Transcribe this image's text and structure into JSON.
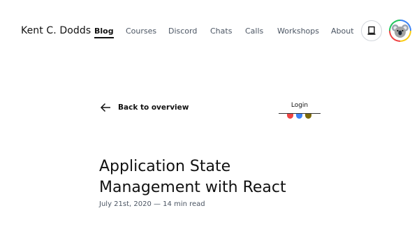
{
  "header": {
    "site_title": "Kent C. Dodds",
    "nav": [
      {
        "label": "Blog",
        "active": true
      },
      {
        "label": "Courses",
        "active": false
      },
      {
        "label": "Discord",
        "active": false
      },
      {
        "label": "Chats",
        "active": false
      },
      {
        "label": "Calls",
        "active": false
      },
      {
        "label": "Workshops",
        "active": false
      },
      {
        "label": "About",
        "active": false
      }
    ],
    "theme_toggle_icon": "laptop-icon",
    "avatar_icon": "koala-avatar"
  },
  "back_link": {
    "label": "Back to overview",
    "icon": "arrow-left-icon"
  },
  "login": {
    "label": "Login",
    "dot_colors": [
      "#ef4444",
      "#3b82f6",
      "#7c6a0a"
    ]
  },
  "post": {
    "title_line1": "Application State",
    "title_line2": "Management with React",
    "meta": "July 21st, 2020 — 14 min read"
  }
}
